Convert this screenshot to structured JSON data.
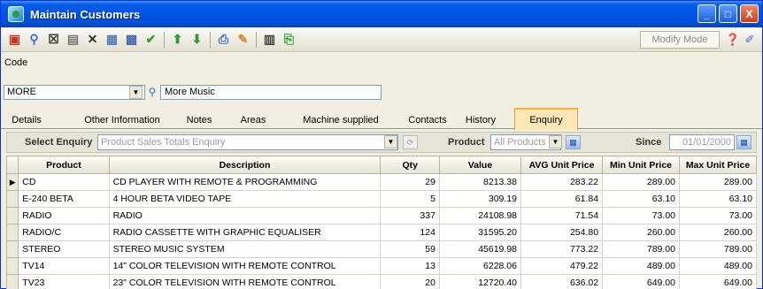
{
  "window": {
    "title": "Maintain Customers",
    "controls": {
      "minimize": "_",
      "maximize": "□",
      "close": "X"
    }
  },
  "toolbar": {
    "icons": [
      "new-record-icon",
      "find-icon",
      "edit-icon",
      "copy-icon",
      "delete-icon",
      "form-icon",
      "save-icon",
      "confirm-icon",
      "move-up-icon",
      "move-down-icon",
      "print-icon",
      "pin-icon",
      "columns-icon",
      "export-icon"
    ],
    "mode": "Modify Mode",
    "help_icon": "help-icon",
    "settings_icon": "pencil-icon"
  },
  "code": {
    "label": "Code",
    "value": "MORE",
    "name": "More Music"
  },
  "tabs": [
    "Details",
    "Other Information",
    "Notes",
    "Areas",
    "Machine supplied",
    "Contacts",
    "History",
    "Enquiry"
  ],
  "active_tab": "Enquiry",
  "enquiry": {
    "select_label": "Select Enquiry",
    "select_value": "Product Sales Totals Enquiry",
    "product_label": "Product",
    "product_value": "All Products",
    "since_label": "Since",
    "since_value": "01/01/2000"
  },
  "table": {
    "columns": [
      "Product",
      "Description",
      "Qty",
      "Value",
      "AVG Unit Price",
      "Min Unit Price",
      "Max Unit Price"
    ],
    "rows": [
      {
        "indicator": "▶",
        "product": "CD",
        "description": "CD PLAYER WITH REMOTE & PROGRAMMING",
        "qty": "29",
        "value": "8213.38",
        "avg": "283.22",
        "min": "289.00",
        "max": "289.00"
      },
      {
        "indicator": "",
        "product": "E-240 BETA",
        "description": "4 HOUR BETA VIDEO TAPE",
        "qty": "5",
        "value": "309.19",
        "avg": "61.84",
        "min": "63.10",
        "max": "63.10"
      },
      {
        "indicator": "",
        "product": "RADIO",
        "description": "RADIO",
        "qty": "337",
        "value": "24108.98",
        "avg": "71.54",
        "min": "73.00",
        "max": "73.00"
      },
      {
        "indicator": "",
        "product": "RADIO/C",
        "description": "RADIO CASSETTE WITH GRAPHIC EQUALISER",
        "qty": "124",
        "value": "31595.20",
        "avg": "254.80",
        "min": "260.00",
        "max": "260.00"
      },
      {
        "indicator": "",
        "product": "STEREO",
        "description": "STEREO MUSIC SYSTEM",
        "qty": "59",
        "value": "45619.98",
        "avg": "773.22",
        "min": "789.00",
        "max": "789.00"
      },
      {
        "indicator": "",
        "product": "TV14",
        "description": "14\" COLOR TELEVISION WITH REMOTE CONTROL",
        "qty": "13",
        "value": "6228.06",
        "avg": "479.22",
        "min": "489.00",
        "max": "489.00"
      },
      {
        "indicator": "",
        "product": "TV23",
        "description": "23\" COLOR TELEVISION WITH REMOTE CONTROL",
        "qty": "20",
        "value": "12720.40",
        "avg": "636.02",
        "min": "649.00",
        "max": "649.00"
      }
    ]
  }
}
